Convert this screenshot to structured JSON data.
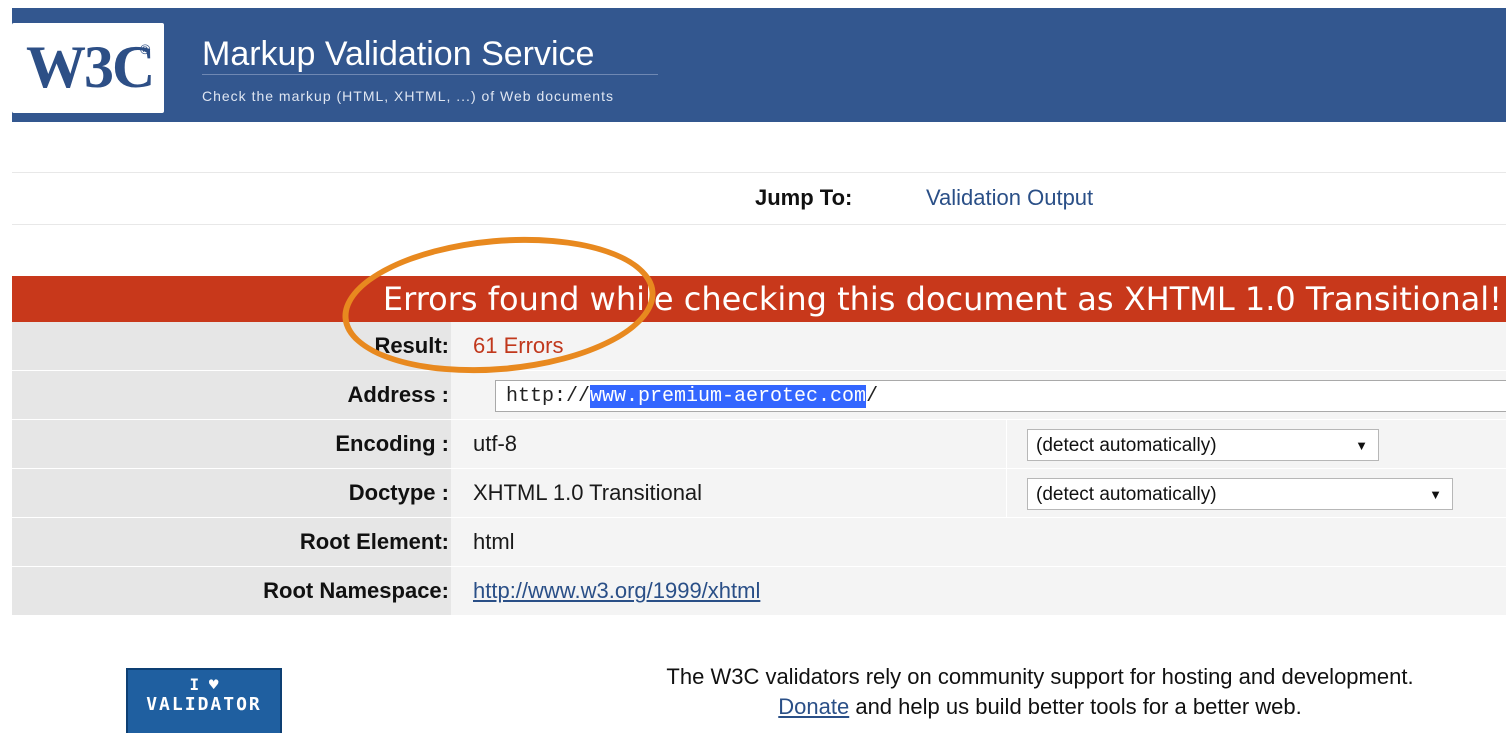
{
  "header": {
    "logo": "W3C",
    "logo_mark": "®",
    "title": "Markup Validation Service",
    "subtitle": "Check the markup (HTML, XHTML, ...) of Web documents"
  },
  "jump": {
    "label": "Jump To:",
    "link": "Validation Output"
  },
  "error_heading": "Errors found while checking this document as XHTML 1.0 Transitional!",
  "results": {
    "result": {
      "label": "Result:",
      "value": "61 Errors"
    },
    "address": {
      "label": "Address :",
      "prefix": "http://",
      "selected": "www.premium-aerotec.com",
      "suffix": "/"
    },
    "encoding": {
      "label": "Encoding :",
      "value": "utf-8",
      "option": "(detect automatically)"
    },
    "doctype": {
      "label": "Doctype :",
      "value": "XHTML 1.0 Transitional",
      "option": "(detect automatically)"
    },
    "root_element": {
      "label": "Root Element:",
      "value": "html"
    },
    "root_namespace": {
      "label": "Root Namespace:",
      "value": "http://www.w3.org/1999/xhtml"
    }
  },
  "footer": {
    "badge_line1": "I ♥",
    "badge_line2": "VALIDATOR",
    "line1": "The W3C validators rely on community support for hosting and development.",
    "donate": "Donate",
    "line2_rest": " and help us build better tools for a better web."
  },
  "colors": {
    "banner": "#33578f",
    "error": "#c8381b",
    "annotation": "#e8891f",
    "link": "#2a4f87"
  }
}
